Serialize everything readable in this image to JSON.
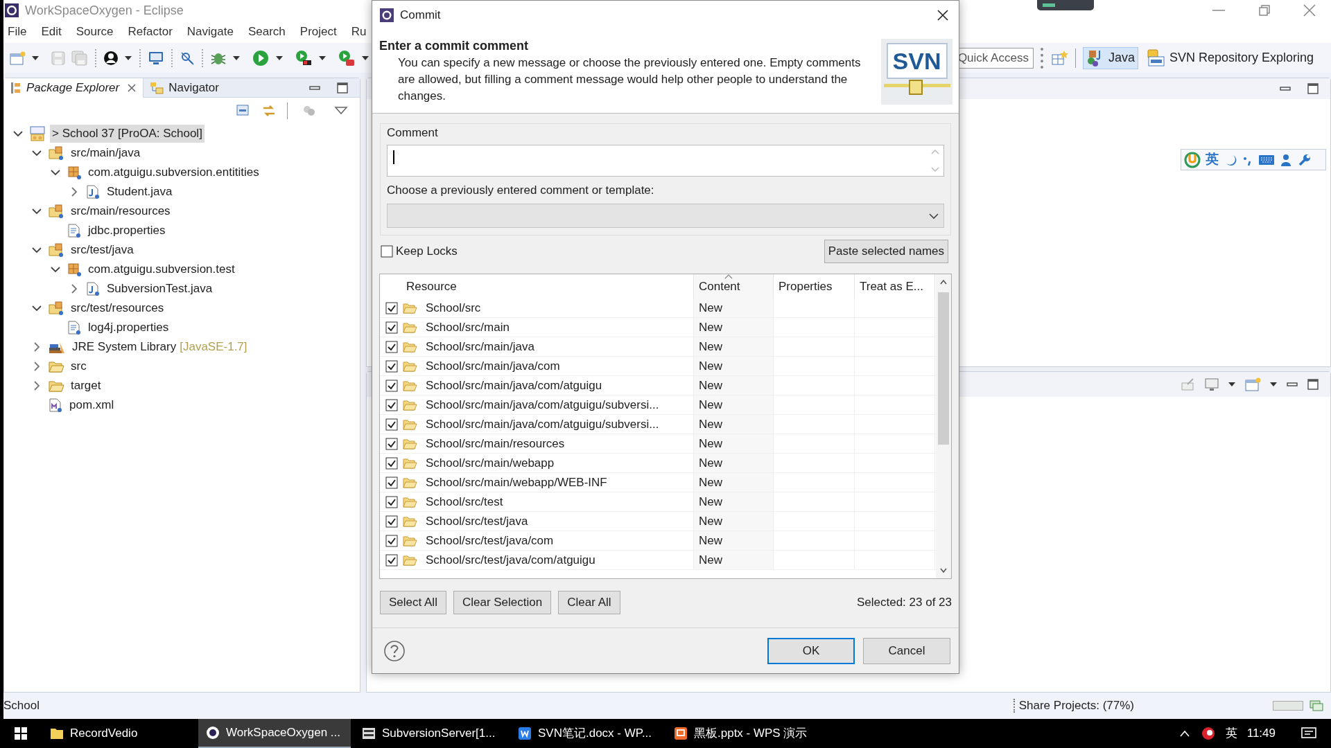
{
  "window": {
    "title": "WorkSpaceOxygen - Eclipse"
  },
  "menu": [
    "File",
    "Edit",
    "Source",
    "Refactor",
    "Navigate",
    "Search",
    "Project",
    "Ru"
  ],
  "quick_access": {
    "placeholder": "Quick Access"
  },
  "perspectives": [
    {
      "label": "Java",
      "selected": true
    },
    {
      "label": "SVN Repository Exploring",
      "selected": false
    }
  ],
  "package_explorer": {
    "tabs": [
      {
        "label": "Package Explorer",
        "selected": true
      },
      {
        "label": "Navigator",
        "selected": false
      }
    ],
    "tree": [
      {
        "label": "> School 37 [ProOA: School]",
        "kind": "project",
        "expanded": true,
        "selected": true,
        "children": [
          {
            "label": "src/main/java",
            "kind": "source-folder",
            "expanded": true,
            "selected": false,
            "children": [
              {
                "label": "com.atguigu.subversion.entitities",
                "kind": "package",
                "expanded": true,
                "selected": false,
                "children": [
                  {
                    "label": "Student.java",
                    "kind": "java-file",
                    "expanded": false,
                    "selected": false
                  }
                ]
              }
            ]
          },
          {
            "label": "src/main/resources",
            "kind": "source-folder",
            "expanded": true,
            "selected": false,
            "children": [
              {
                "label": "jdbc.properties",
                "kind": "properties-file",
                "selected": false
              }
            ]
          },
          {
            "label": "src/test/java",
            "kind": "source-folder",
            "expanded": true,
            "selected": false,
            "children": [
              {
                "label": "com.atguigu.subversion.test",
                "kind": "package",
                "expanded": true,
                "selected": false,
                "children": [
                  {
                    "label": "SubversionTest.java",
                    "kind": "java-file",
                    "expanded": false,
                    "selected": false
                  }
                ]
              }
            ]
          },
          {
            "label": "src/test/resources",
            "kind": "source-folder",
            "expanded": true,
            "selected": false,
            "children": [
              {
                "label": "log4j.properties",
                "kind": "properties-file",
                "selected": false
              }
            ]
          },
          {
            "label": "JRE System Library",
            "decoration": "[JavaSE-1.7]",
            "kind": "library",
            "expanded": false,
            "selected": false
          },
          {
            "label": "src",
            "kind": "folder",
            "expanded": false,
            "selected": false
          },
          {
            "label": "target",
            "kind": "folder",
            "expanded": false,
            "selected": false
          },
          {
            "label": "pom.xml",
            "kind": "xml-file",
            "selected": false
          }
        ]
      }
    ]
  },
  "ime_toolbar": {
    "language": "英"
  },
  "dialog": {
    "title": "Commit",
    "heading": "Enter a commit comment",
    "description": "You can specify a new message or choose the previously entered one. Empty comments are allowed, but filling a comment message would help other people to understand the changes.",
    "logo": "SVN",
    "comment": {
      "label": "Comment"
    },
    "template": {
      "label": "Choose a previously entered comment or template:"
    },
    "keep_locks": {
      "label": "Keep Locks",
      "checked": false
    },
    "paste_button": "Paste selected names",
    "table": {
      "columns": [
        {
          "label": "Resource",
          "sorted": false
        },
        {
          "label": "Content",
          "sorted": true
        },
        {
          "label": "Properties",
          "sorted": false
        },
        {
          "label": "Treat as E...",
          "sorted": false
        }
      ],
      "rows": [
        {
          "checked": true,
          "resource": "School/src",
          "content": "New"
        },
        {
          "checked": true,
          "resource": "School/src/main",
          "content": "New"
        },
        {
          "checked": true,
          "resource": "School/src/main/java",
          "content": "New"
        },
        {
          "checked": true,
          "resource": "School/src/main/java/com",
          "content": "New"
        },
        {
          "checked": true,
          "resource": "School/src/main/java/com/atguigu",
          "content": "New"
        },
        {
          "checked": true,
          "resource": "School/src/main/java/com/atguigu/subversi...",
          "content": "New"
        },
        {
          "checked": true,
          "resource": "School/src/main/java/com/atguigu/subversi...",
          "content": "New"
        },
        {
          "checked": true,
          "resource": "School/src/main/resources",
          "content": "New"
        },
        {
          "checked": true,
          "resource": "School/src/main/webapp",
          "content": "New"
        },
        {
          "checked": true,
          "resource": "School/src/main/webapp/WEB-INF",
          "content": "New"
        },
        {
          "checked": true,
          "resource": "School/src/test",
          "content": "New"
        },
        {
          "checked": true,
          "resource": "School/src/test/java",
          "content": "New"
        },
        {
          "checked": true,
          "resource": "School/src/test/java/com",
          "content": "New"
        },
        {
          "checked": true,
          "resource": "School/src/test/java/com/atguigu",
          "content": "New"
        }
      ]
    },
    "selection_buttons": [
      "Select All",
      "Clear Selection",
      "Clear All"
    ],
    "selected_count": "Selected: 23 of 23",
    "buttons": [
      {
        "label": "OK",
        "default": true
      },
      {
        "label": "Cancel",
        "default": false
      }
    ]
  },
  "status_bar": {
    "left": "School",
    "progress": "Share Projects: (77%)"
  },
  "taskbar": {
    "items": [
      {
        "label": "RecordVedio",
        "kind": "folder",
        "selected": false
      },
      {
        "label": "WorkSpaceOxygen ...",
        "kind": "eclipse",
        "selected": true
      },
      {
        "label": "SubversionServer[1...",
        "kind": "server",
        "selected": false
      },
      {
        "label": "SVN笔记.docx - WP...",
        "kind": "writer",
        "selected": false
      },
      {
        "label": "黑板.pptx - WPS 演示",
        "kind": "slides",
        "selected": false
      }
    ],
    "tray": {
      "ime": "英",
      "time": "11:49"
    }
  }
}
